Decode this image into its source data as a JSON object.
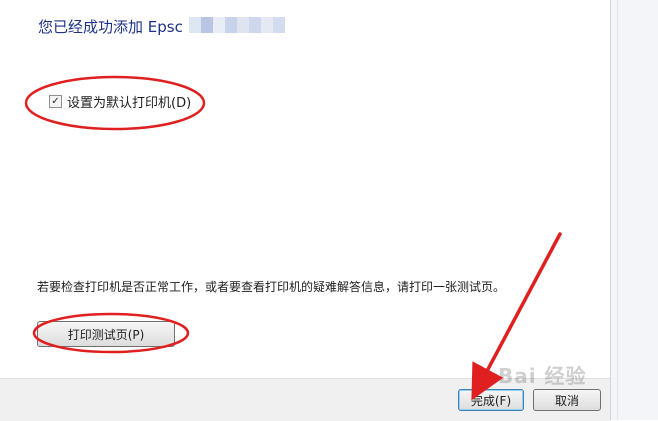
{
  "dialog": {
    "title": "您已经成功添加 Epsc",
    "default_printer_checkbox": {
      "label": "设置为默认打印机(D)",
      "checked": true
    },
    "info_text": "若要检查打印机是否正常工作，或者要查看打印机的疑难解答信息，请打印一张测试页。",
    "print_test_page_button": "打印测试页(P)"
  },
  "footer": {
    "finish_button": "完成(F)",
    "cancel_button": "取消"
  },
  "watermark": {
    "text": "Bai 经验"
  },
  "annotations": {
    "highlight_color": "#e02020",
    "arrow_color": "#e02020"
  }
}
